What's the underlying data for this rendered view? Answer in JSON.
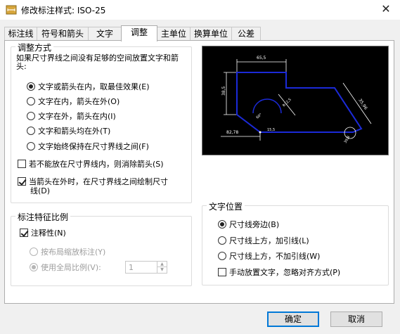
{
  "window": {
    "title": "修改标注样式: ISO-25",
    "close_glyph": "✕"
  },
  "tabs": [
    {
      "label": "标注线"
    },
    {
      "label": "符号和箭头"
    },
    {
      "label": "文字"
    },
    {
      "label": "调整",
      "active": true
    },
    {
      "label": "主单位"
    },
    {
      "label": "换算单位"
    },
    {
      "label": "公差"
    }
  ],
  "fit_options": {
    "title": "调整方式",
    "description": "如果尺寸界线之间没有足够的空间放置文字和箭头:",
    "options": [
      {
        "label": "文字或箭头在内，取最佳效果(E)",
        "selected": true
      },
      {
        "label": "文字在内，箭头在外(O)",
        "selected": false
      },
      {
        "label": "文字在外，箭头在内(I)",
        "selected": false
      },
      {
        "label": "文字和箭头均在外(T)",
        "selected": false
      },
      {
        "label": "文字始终保持在尺寸界线之间(F)",
        "selected": false
      }
    ],
    "suppress_arrows": {
      "label": "若不能放在尺寸界线内，则消除箭头(S)",
      "checked": false
    },
    "draw_dimline": {
      "label_line1": "当箭头在外时，在尺寸界线之间绘制尺寸",
      "label_line2": "线(D)",
      "checked": true
    }
  },
  "scale": {
    "title": "标注特征比例",
    "annotative": {
      "label": "注释性(N)",
      "checked": true
    },
    "layout_scale": {
      "label": "按布局缩放标注(Y)",
      "selected": false,
      "disabled": true
    },
    "global_scale": {
      "label": "使用全局比例(V):",
      "selected": true,
      "disabled": true
    },
    "global_scale_value": "1"
  },
  "text_placement": {
    "title": "文字位置",
    "options": [
      {
        "label": "尺寸线旁边(B)",
        "selected": true
      },
      {
        "label": "尺寸线上方，加引线(L)",
        "selected": false
      },
      {
        "label": "尺寸线上方，不加引线(W)",
        "selected": false
      }
    ],
    "manual": {
      "label": "手动放置文字，忽略对齐方式(P)",
      "checked": false
    }
  },
  "preview": {
    "labels": [
      "65,5",
      "38,5",
      "35,96",
      "R12,5",
      "82,78",
      "60°",
      "15,5",
      "39,8"
    ]
  },
  "buttons": {
    "ok": "确定",
    "cancel": "取消"
  },
  "colors": {
    "preview_bg": "#000000",
    "preview_line": "#1b2ad8",
    "preview_dim": "#ffffff",
    "default_button_border": "#0078d7"
  }
}
